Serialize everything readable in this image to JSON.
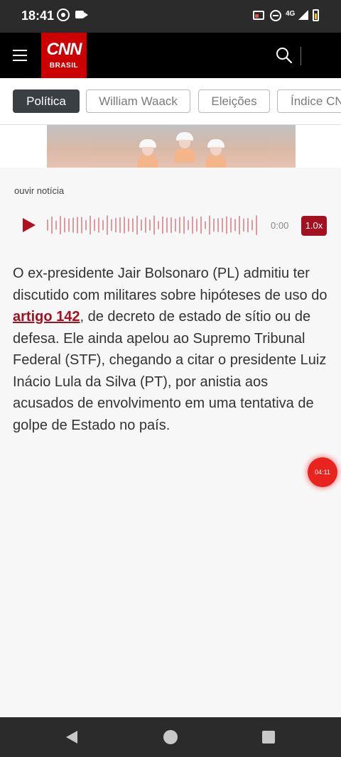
{
  "status_bar": {
    "time": "18:41",
    "network": "4G",
    "icons": [
      "whatsapp-icon",
      "video-camera-icon",
      "cast-icon",
      "do-not-disturb-icon",
      "signal-icon",
      "battery-icon"
    ]
  },
  "header": {
    "logo_main": "CNN",
    "logo_sub": "BRASIL",
    "icons": [
      "menu-icon",
      "search-icon"
    ],
    "brand_color": "#cc0000"
  },
  "tabs": [
    {
      "label": "Política",
      "active": true
    },
    {
      "label": "William Waack",
      "active": false
    },
    {
      "label": "Eleições",
      "active": false
    },
    {
      "label": "Índice CNN",
      "active": false
    }
  ],
  "audio": {
    "label": "ouvir notícia",
    "time": "0:00",
    "speed": "1.0x",
    "accent_color": "#a3111e"
  },
  "article": {
    "text_before": "O ex-presidente Jair Bolsonaro (PL) admitiu ter discutido com militares sobre hipóteses de uso do ",
    "link_text": "artigo 142",
    "text_after": ", de decreto de estado de sítio ou de defesa. Ele ainda apelou ao Supremo Tribunal Federal (STF), chegando a citar o presidente Luiz Inácio Lula da Silva (PT), por anistia aos acusados de envolvimento em uma tentativa de golpe de Estado no país."
  },
  "floating_button": {
    "label": "04:11"
  },
  "navigation": {
    "icons": [
      "back-icon",
      "home-icon",
      "recents-icon"
    ]
  }
}
